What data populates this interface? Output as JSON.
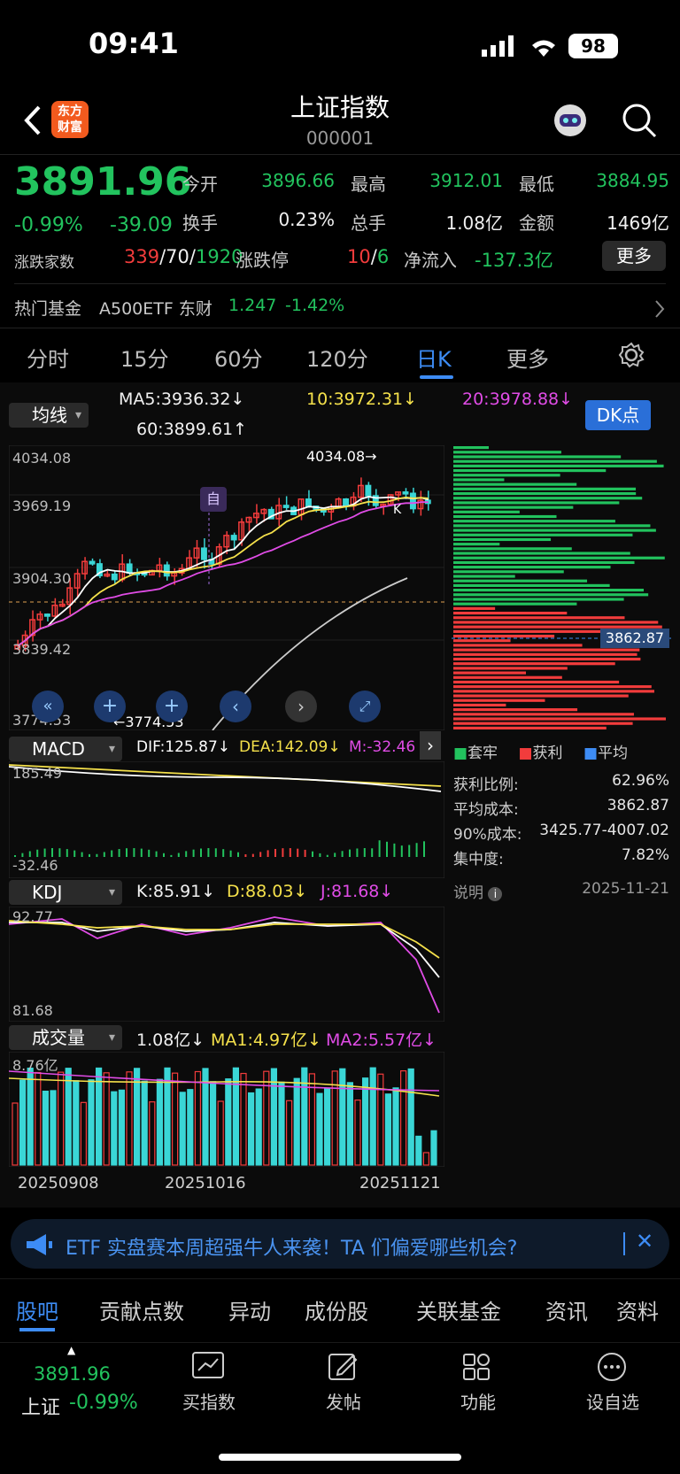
{
  "status_bar": {
    "time": "09:41",
    "battery": "98"
  },
  "header": {
    "title": "上证指数",
    "code": "000001",
    "logo_text": "东方财富"
  },
  "quote": {
    "price": "3891.96",
    "change_pct": "-0.99%",
    "change": "-39.09",
    "open_label": "今开",
    "open": "3896.66",
    "high_label": "最高",
    "high": "3912.01",
    "low_label": "最低",
    "low": "3884.95",
    "turnover_label": "换手",
    "turnover": "0.23%",
    "volume_label": "总手",
    "volume": "1.08亿",
    "amount_label": "金额",
    "amount": "1469亿",
    "breadth_label": "涨跌家数",
    "up": "339",
    "flat": "70",
    "down": "1920",
    "limit_label": "涨跌停",
    "limit_up": "10",
    "limit_down": "6",
    "inflow_label": "净流入",
    "inflow": "-137.3亿",
    "more_button": "更多"
  },
  "hot_fund": {
    "label": "热门基金",
    "name": "A500ETF 东财",
    "price": "1.247",
    "change": "-1.42%"
  },
  "period_tabs": [
    "分时",
    "15分",
    "60分",
    "120分",
    "日K",
    "更多"
  ],
  "active_tab": "日K",
  "main_chart": {
    "indicator_select": "均线",
    "ma5": "MA5:3936.32↓",
    "ma10": "10:3972.31↓",
    "ma20": "20:3978.88↓",
    "ma60": "60:3899.61↑",
    "dk_button": "DK点",
    "y_ticks": [
      "4034.08",
      "3969.19",
      "3904.30",
      "3839.42",
      "3774.53"
    ],
    "high_mark": "4034.08→",
    "low_mark": "←3774.53",
    "marker_zi": "自",
    "marker_k": "K",
    "cost_price_tag": "3862.87"
  },
  "macd": {
    "select": "MACD",
    "dif": "DIF:125.87↓",
    "dea": "DEA:142.09↓",
    "m": "M:-32.46",
    "top": "185.49",
    "bottom": "-32.46"
  },
  "kdj": {
    "select": "KDJ",
    "k": "K:85.91↓",
    "d": "D:88.03↓",
    "j": "J:81.68↓",
    "top": "92.77",
    "bottom": "81.68"
  },
  "vol": {
    "select": "成交量",
    "v": "1.08亿↓",
    "ma1": "MA1:4.97亿↓",
    "ma2": "MA2:5.57亿↓",
    "top": "8.76亿"
  },
  "x_dates": [
    "20250908",
    "20251016",
    "20251121"
  ],
  "chip": {
    "legend": [
      "套牢",
      "获利",
      "平均"
    ],
    "profit_ratio_label": "获利比例:",
    "profit_ratio": "62.96%",
    "avg_cost_label": "平均成本:",
    "avg_cost": "3862.87",
    "cost90_label": "90%成本:",
    "cost90": "3425.77-4007.02",
    "concentration_label": "集中度:",
    "concentration": "7.82%",
    "note_label": "说明",
    "date": "2025-11-21"
  },
  "banner": {
    "text": "ETF 实盘赛本周超强牛人来袭！TA 们偏爱哪些机会?"
  },
  "bottom_tabs": [
    "股吧",
    "贡献点数",
    "异动",
    "成份股",
    "关联基金",
    "资讯",
    "资料"
  ],
  "bottom_nav": {
    "index_price": "3891.96",
    "index_name": "上证",
    "index_change": "-0.99%",
    "items": [
      "买指数",
      "发帖",
      "功能",
      "设自选"
    ]
  },
  "colors": {
    "up": "#f23c3c",
    "down": "#22c35e",
    "accent": "#3d8cf5"
  }
}
